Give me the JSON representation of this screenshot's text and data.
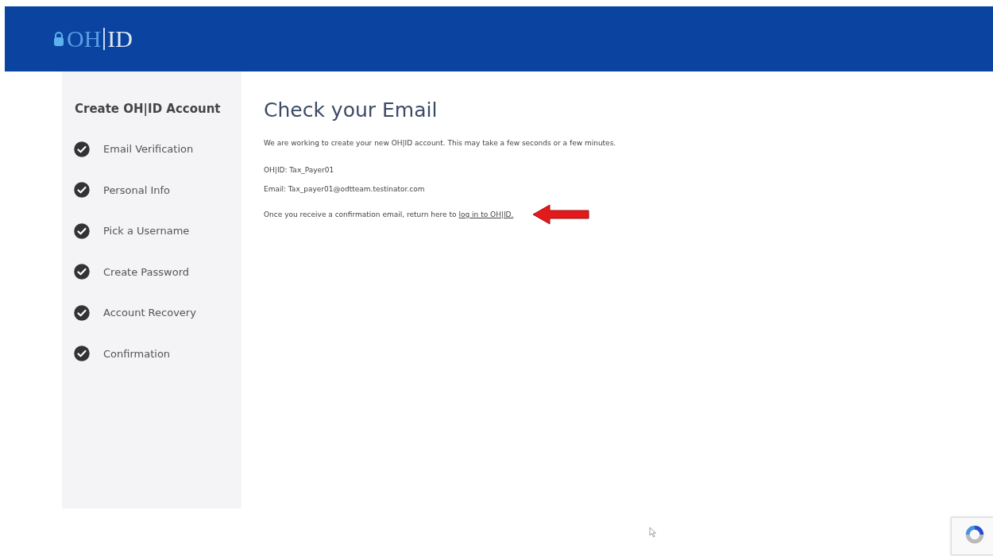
{
  "header": {
    "logo_left": "OH",
    "logo_right": "ID"
  },
  "sidebar": {
    "title": "Create OH|ID Account",
    "steps": [
      {
        "label": "Email Verification",
        "completed": true
      },
      {
        "label": "Personal Info",
        "completed": true
      },
      {
        "label": "Pick a Username",
        "completed": true
      },
      {
        "label": "Create Password",
        "completed": true
      },
      {
        "label": "Account Recovery",
        "completed": true
      },
      {
        "label": "Confirmation",
        "completed": true
      }
    ]
  },
  "main": {
    "title": "Check your Email",
    "intro": "We are working to create your new OH|ID account. This may take a few seconds or a few minutes.",
    "ohid_line": "OH|ID: Tax_Payer01",
    "email_line": "Email: Tax_payer01@odtteam.testinator.com",
    "return_text": "Once you receive a confirmation email, return here to",
    "login_link": "log in to OH|ID."
  }
}
